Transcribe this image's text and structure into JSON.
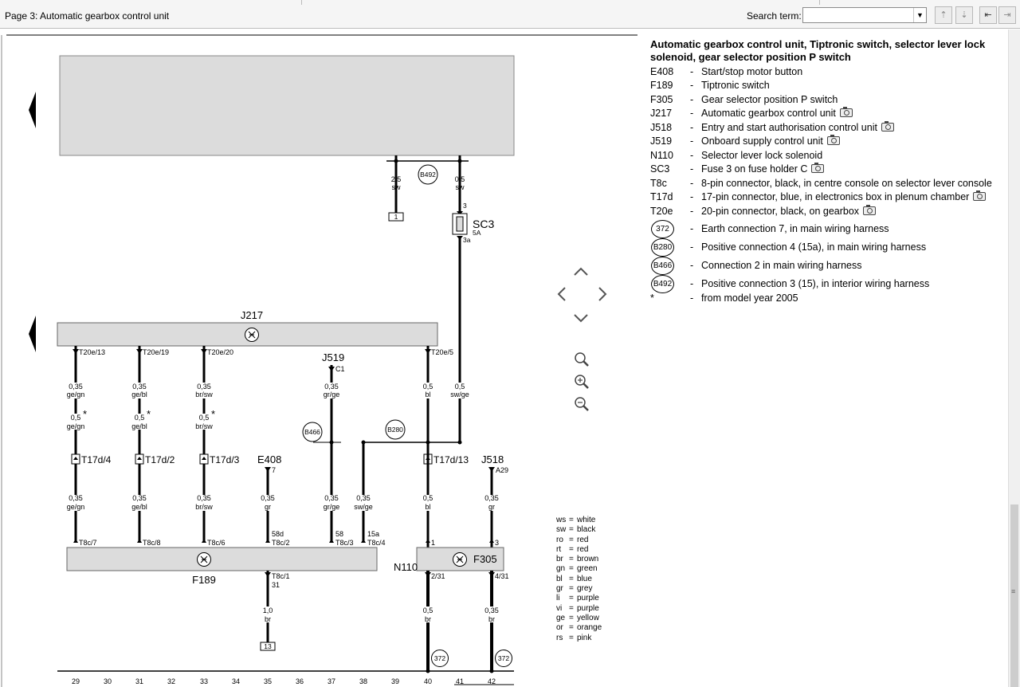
{
  "window": {
    "title": "Page 3: Automatic gearbox control unit",
    "search_label": "Search term:",
    "search_value": ""
  },
  "legend": {
    "title": "Automatic gearbox control unit, Tiptronic switch, selector lever lock solenoid, gear selector position P switch",
    "items": [
      {
        "code": "E408",
        "desc": "Start/stop motor button",
        "photo": false
      },
      {
        "code": "F189",
        "desc": "Tiptronic switch",
        "photo": false
      },
      {
        "code": "F305",
        "desc": "Gear selector position P switch",
        "photo": false
      },
      {
        "code": "J217",
        "desc": "Automatic gearbox control unit",
        "photo": true
      },
      {
        "code": "J518",
        "desc": "Entry and start authorisation control unit",
        "photo": true
      },
      {
        "code": "J519",
        "desc": "Onboard supply control unit",
        "photo": true
      },
      {
        "code": "N110",
        "desc": "Selector lever lock solenoid",
        "photo": false
      },
      {
        "code": "SC3",
        "desc": "Fuse 3 on fuse holder C",
        "photo": true
      },
      {
        "code": "T8c",
        "desc": "8-pin connector, black, in centre console on selector lever console",
        "photo": false
      },
      {
        "code": "T17d",
        "desc": "17-pin connector, blue, in electronics box in plenum chamber",
        "photo": true
      },
      {
        "code": "T20e",
        "desc": "20-pin connector, black, on gearbox",
        "photo": true
      },
      {
        "code": "372",
        "desc": "Earth connection 7, in main wiring harness",
        "circle": true
      },
      {
        "code": "B280",
        "desc": "Positive connection 4 (15a), in main wiring harness",
        "circle": true
      },
      {
        "code": "B466",
        "desc": "Connection 2 in main wiring harness",
        "circle": true
      },
      {
        "code": "B492",
        "desc": "Positive connection 3 (15), in interior wiring harness",
        "circle": true
      },
      {
        "code": "*",
        "desc": "from model year 2005",
        "photo": false
      }
    ]
  },
  "colors": [
    {
      "abbr": "ws",
      "name": "white"
    },
    {
      "abbr": "sw",
      "name": "black"
    },
    {
      "abbr": "ro",
      "name": "red"
    },
    {
      "abbr": "rt",
      "name": "red"
    },
    {
      "abbr": "br",
      "name": "brown"
    },
    {
      "abbr": "gn",
      "name": "green"
    },
    {
      "abbr": "bl",
      "name": "blue"
    },
    {
      "abbr": "gr",
      "name": "grey"
    },
    {
      "abbr": "li",
      "name": "purple"
    },
    {
      "abbr": "vi",
      "name": "purple"
    },
    {
      "abbr": "ge",
      "name": "yellow"
    },
    {
      "abbr": "or",
      "name": "orange"
    },
    {
      "abbr": "rs",
      "name": "pink"
    }
  ],
  "diagram": {
    "components": {
      "j217": "J217",
      "j519": "J519",
      "j518": "J518",
      "e408": "E408",
      "f189": "F189",
      "f305": "F305",
      "n110": "N110",
      "sc3": "SC3",
      "sc3_rating": "5A"
    },
    "connections": {
      "b492": "B492",
      "b466": "B466",
      "b280": "B280",
      "e372a": "372",
      "e372b": "372"
    },
    "ref_boxes": {
      "top": "1",
      "bottom": "13"
    },
    "pins": {
      "t20e13": "T20e/13",
      "t20e19": "T20e/19",
      "t20e20": "T20e/20",
      "t20e5": "T20e/5",
      "j519c1": "C1",
      "j518a29": "A29",
      "e408_7": "7",
      "sc3_in": "3",
      "sc3_out": "3a",
      "t17d4": "T17d/4",
      "t17d2": "T17d/2",
      "t17d3": "T17d/3",
      "t17d13": "T17d/13",
      "t8c7": "T8c/7",
      "t8c8": "T8c/8",
      "t8c6": "T8c/6",
      "t8c2": "T8c/2",
      "t8c3": "T8c/3",
      "t8c4": "T8c/4",
      "t8c1": "T8c/1",
      "p58d": "58d",
      "p58": "58",
      "p15a": "15a",
      "p31": "31",
      "n110_1": "1",
      "n110_231": "2/31",
      "f305_3": "3",
      "f305_431": "4/31"
    },
    "wires": {
      "w1a": "2,5",
      "w1b": "sw",
      "w2a": "0,5",
      "w2b": "sw",
      "w3a": "0,35",
      "w3b": "ge/gn",
      "w3c": "0,5",
      "w3d": "ge/gn",
      "w3e": "0,35",
      "w3f": "ge/gn",
      "w4a": "0,35",
      "w4b": "ge/bl",
      "w4c": "0,5",
      "w4d": "ge/bl",
      "w4e": "0,35",
      "w4f": "ge/bl",
      "w5a": "0,35",
      "w5b": "br/sw",
      "w5c": "0,5",
      "w5d": "br/sw",
      "w5e": "0,35",
      "w5f": "br/sw",
      "w6a": "0,35",
      "w6b": "gr/ge",
      "w6c": "0,35",
      "w6d": "gr/ge",
      "w7a": "0,35",
      "w7b": "gr",
      "w8a": "0,35",
      "w8b": "sw/ge",
      "w9a": "0,5",
      "w9b": "bl",
      "w9c": "0,5",
      "w9d": "bl",
      "w9e": "0,5",
      "w9f": "br",
      "w10a": "0,5",
      "w10b": "sw/ge",
      "w11a": "0,35",
      "w11b": "gr",
      "w11c": "0,35",
      "w11d": "br",
      "w12a": "1,0",
      "w12b": "br"
    },
    "star": "*",
    "track_numbers": [
      "29",
      "30",
      "31",
      "32",
      "33",
      "34",
      "35",
      "36",
      "37",
      "38",
      "39",
      "40",
      "41",
      "42"
    ]
  }
}
